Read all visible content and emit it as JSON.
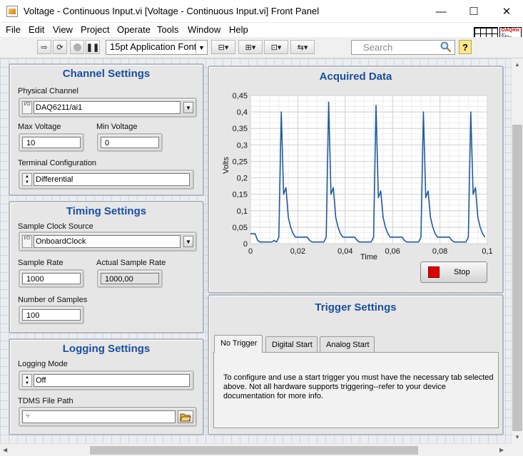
{
  "window": {
    "title": "Voltage - Continuous Input.vi [Voltage - Continuous Input.vi] Front Panel",
    "minimize": "—",
    "maximize": "☐",
    "close": "✕"
  },
  "menu": [
    "File",
    "Edit",
    "View",
    "Project",
    "Operate",
    "Tools",
    "Window",
    "Help"
  ],
  "toolbar": {
    "font": "15pt Application Font",
    "search_placeholder": "Search",
    "help": "?",
    "daqmx_label": "DAQmx",
    "daqmx_sub": "Example"
  },
  "channel_settings": {
    "title": "Channel Settings",
    "physical_channel_label": "Physical Channel",
    "physical_channel_value": "DAQ6211/ai1",
    "io_prefix": "I/O",
    "max_voltage_label": "Max Voltage",
    "max_voltage_value": "10",
    "min_voltage_label": "Min Voltage",
    "min_voltage_value": "0",
    "terminal_config_label": "Terminal Configuration",
    "terminal_config_value": "Differential"
  },
  "timing_settings": {
    "title": "Timing Settings",
    "sample_clock_label": "Sample Clock Source",
    "sample_clock_value": "OnboardClock",
    "sample_rate_label": "Sample Rate",
    "sample_rate_value": "1000",
    "actual_rate_label": "Actual Sample Rate",
    "actual_rate_value": "1000,00",
    "num_samples_label": "Number of Samples",
    "num_samples_value": "100"
  },
  "logging_settings": {
    "title": "Logging Settings",
    "logging_mode_label": "Logging Mode",
    "logging_mode_value": "Off",
    "tdms_path_label": "TDMS File Path",
    "tdms_path_value": ""
  },
  "acquired_data": {
    "title": "Acquired Data",
    "stop_label": "Stop"
  },
  "trigger_settings": {
    "title": "Trigger Settings",
    "tabs": [
      "No Trigger",
      "Digital Start",
      "Analog Start"
    ],
    "active_tab": 0,
    "message": "To configure and use a start trigger you must have the necessary tab selected above.  Not all hardware supports triggering--refer to your device documentation for more info."
  },
  "colors": {
    "title_blue": "#1a4fa0",
    "trace": "#1f5a9e",
    "stop_led": "#e00000"
  },
  "chart_data": {
    "type": "line",
    "title": "",
    "xlabel": "Time",
    "ylabel": "Volts",
    "xlim": [
      0,
      0.1
    ],
    "ylim": [
      0,
      0.45
    ],
    "x_ticks": [
      "0",
      "0,02",
      "0,04",
      "0,06",
      "0,08",
      "0,1"
    ],
    "y_ticks": [
      "0",
      "0,05",
      "0,1",
      "0,15",
      "0,2",
      "0,25",
      "0,3",
      "0,35",
      "0,4",
      "0,45"
    ],
    "grid": true,
    "series": [
      {
        "x": [
          0,
          0.001,
          0.002,
          0.003,
          0.004,
          0.005,
          0.006,
          0.007,
          0.008,
          0.009,
          0.01,
          0.011,
          0.012,
          0.013,
          0.014,
          0.015,
          0.016,
          0.017,
          0.018,
          0.019,
          0.02,
          0.021,
          0.022,
          0.023,
          0.024,
          0.025,
          0.026,
          0.027,
          0.028,
          0.029,
          0.03,
          0.031,
          0.032,
          0.033,
          0.034,
          0.035,
          0.036,
          0.037,
          0.038,
          0.039,
          0.04,
          0.041,
          0.042,
          0.043,
          0.044,
          0.045,
          0.046,
          0.047,
          0.048,
          0.049,
          0.05,
          0.051,
          0.052,
          0.053,
          0.054,
          0.055,
          0.056,
          0.057,
          0.058,
          0.059,
          0.06,
          0.061,
          0.062,
          0.063,
          0.064,
          0.065,
          0.066,
          0.067,
          0.068,
          0.069,
          0.07,
          0.071,
          0.072,
          0.073,
          0.074,
          0.075,
          0.076,
          0.077,
          0.078,
          0.079,
          0.08,
          0.081,
          0.082,
          0.083,
          0.084,
          0.085,
          0.086,
          0.087,
          0.088,
          0.089,
          0.09,
          0.091,
          0.092,
          0.093,
          0.094,
          0.095,
          0.096,
          0.097,
          0.098,
          0.099
        ],
        "y": [
          0.03,
          0.03,
          0.03,
          0.01,
          0.005,
          0.005,
          0.005,
          0.005,
          0.005,
          0.005,
          0.01,
          0.005,
          0.02,
          0.4,
          0.15,
          0.17,
          0.08,
          0.05,
          0.03,
          0.02,
          0.02,
          0.02,
          0.02,
          0.02,
          0.02,
          0.01,
          0.005,
          0.005,
          0.005,
          0.005,
          0.005,
          0.005,
          0.02,
          0.43,
          0.15,
          0.17,
          0.08,
          0.05,
          0.03,
          0.02,
          0.02,
          0.02,
          0.02,
          0.02,
          0.02,
          0.01,
          0.005,
          0.005,
          0.005,
          0.005,
          0.005,
          0.005,
          0.02,
          0.42,
          0.14,
          0.16,
          0.08,
          0.05,
          0.03,
          0.02,
          0.02,
          0.02,
          0.02,
          0.02,
          0.02,
          0.01,
          0.005,
          0.005,
          0.005,
          0.005,
          0.005,
          0.005,
          0.02,
          0.4,
          0.14,
          0.16,
          0.08,
          0.05,
          0.03,
          0.02,
          0.02,
          0.02,
          0.02,
          0.02,
          0.02,
          0.01,
          0.005,
          0.005,
          0.005,
          0.005,
          0.005,
          0.005,
          0.02,
          0.4,
          0.15,
          0.17,
          0.08,
          0.05,
          0.03,
          0.02
        ]
      }
    ]
  }
}
